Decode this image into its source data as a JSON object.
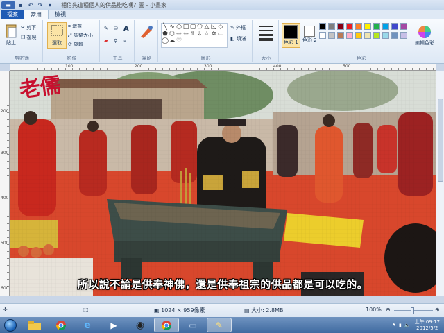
{
  "window": {
    "title": "相信先這種個人的供品能吃嗎？圖 - 小畫家"
  },
  "tabs": [
    "檔案",
    "常用",
    "檢視"
  ],
  "ribbon": {
    "clipboard": {
      "label": "剪貼簿",
      "paste": "貼上",
      "cut": "剪下",
      "copy": "複製"
    },
    "image": {
      "label": "影像",
      "select": "選取",
      "crop": "裁剪",
      "resize": "調整大小",
      "rotate": "旋轉"
    },
    "tools": {
      "label": "工具",
      "text_tool": "A"
    },
    "brushes": {
      "label": "筆刷"
    },
    "shapes": {
      "label": "圖形",
      "outline": "外框",
      "fill": "填滿"
    },
    "size": {
      "label": "大小"
    },
    "colors": {
      "label": "色彩",
      "color1": "色彩 1",
      "color2": "色彩 2",
      "edit": "編輯色彩",
      "palette": [
        "#000000",
        "#7f7f7f",
        "#880015",
        "#ed1c24",
        "#ff7f27",
        "#fff200",
        "#22b14c",
        "#00a2e8",
        "#3f48cc",
        "#a349a4",
        "#ffffff",
        "#c3c3c3",
        "#b97a57",
        "#ffaec9",
        "#ffc90e",
        "#efe4b0",
        "#b5e61d",
        "#99d9ea",
        "#7092be",
        "#c8bfe7"
      ]
    }
  },
  "ruler": {
    "h_ticks": [
      "100",
      "200",
      "300",
      "400",
      "500"
    ],
    "v_ticks": [
      "200",
      "300",
      "400",
      "500",
      "600"
    ]
  },
  "canvas": {
    "logo_text": "老儒",
    "subtitle": "所以說不論是供奉神佛，還是供奉祖宗的供品都是可以吃的。"
  },
  "status": {
    "dimensions": "1024 × 959像素",
    "size": "大小: 2.8MB",
    "zoom": "100%"
  },
  "taskbar": {
    "time": "上午 09:17",
    "date": "2012/5/2"
  }
}
